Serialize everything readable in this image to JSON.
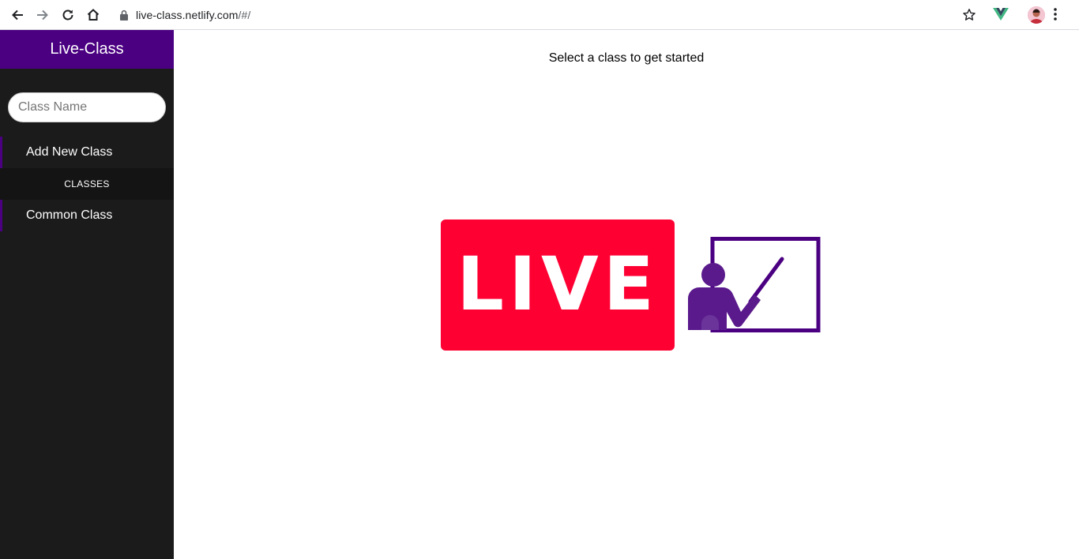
{
  "browser": {
    "url_host": "live-class.netlify.com",
    "url_path": "/#/",
    "icons": [
      "back-icon",
      "forward-icon",
      "reload-icon",
      "home-icon",
      "lock-icon",
      "bookmark-star-icon",
      "vue-devtools-icon",
      "profile-avatar",
      "kebab-menu-icon"
    ]
  },
  "sidebar": {
    "title": "Live-Class",
    "search_placeholder": "Class Name",
    "add_label": "Add New Class",
    "section_label": "CLASSES",
    "items": [
      {
        "label": "Common Class"
      }
    ]
  },
  "main": {
    "prompt": "Select a class to get started",
    "live_badge": "LIVE"
  },
  "colors": {
    "brand_purple": "#4b0082",
    "sidebar_bg": "#1b1b1b",
    "live_red": "#ff0033"
  }
}
